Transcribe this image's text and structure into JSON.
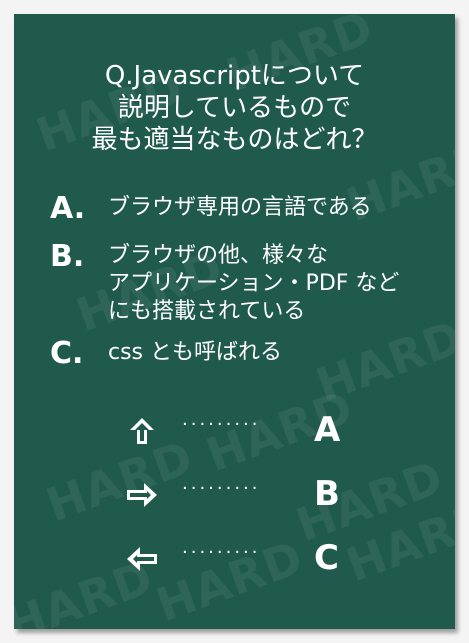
{
  "question": {
    "lines": [
      "Q.Javascriptについて",
      "説明しているもので",
      "最も適当なものはどれ？"
    ]
  },
  "options": [
    {
      "letter": "A.",
      "lines": [
        "ブラウザ専用の言語である"
      ]
    },
    {
      "letter": "B.",
      "lines": [
        "ブラウザの他、様々な",
        "アプリケーション・PDF など",
        "にも搭載されている"
      ]
    },
    {
      "letter": "C.",
      "lines": [
        "css とも呼ばれる"
      ]
    }
  ],
  "nav": [
    {
      "icon": "arrow-up-icon",
      "dots": "·········",
      "letter": "A"
    },
    {
      "icon": "arrow-right-icon",
      "dots": "·········",
      "letter": "B"
    },
    {
      "icon": "arrow-left-icon",
      "dots": "·········",
      "letter": "C"
    }
  ],
  "watermark": "HARD",
  "colors": {
    "board": "#1f5a4c",
    "text": "#ffffff",
    "background": "#f4f4f4"
  }
}
